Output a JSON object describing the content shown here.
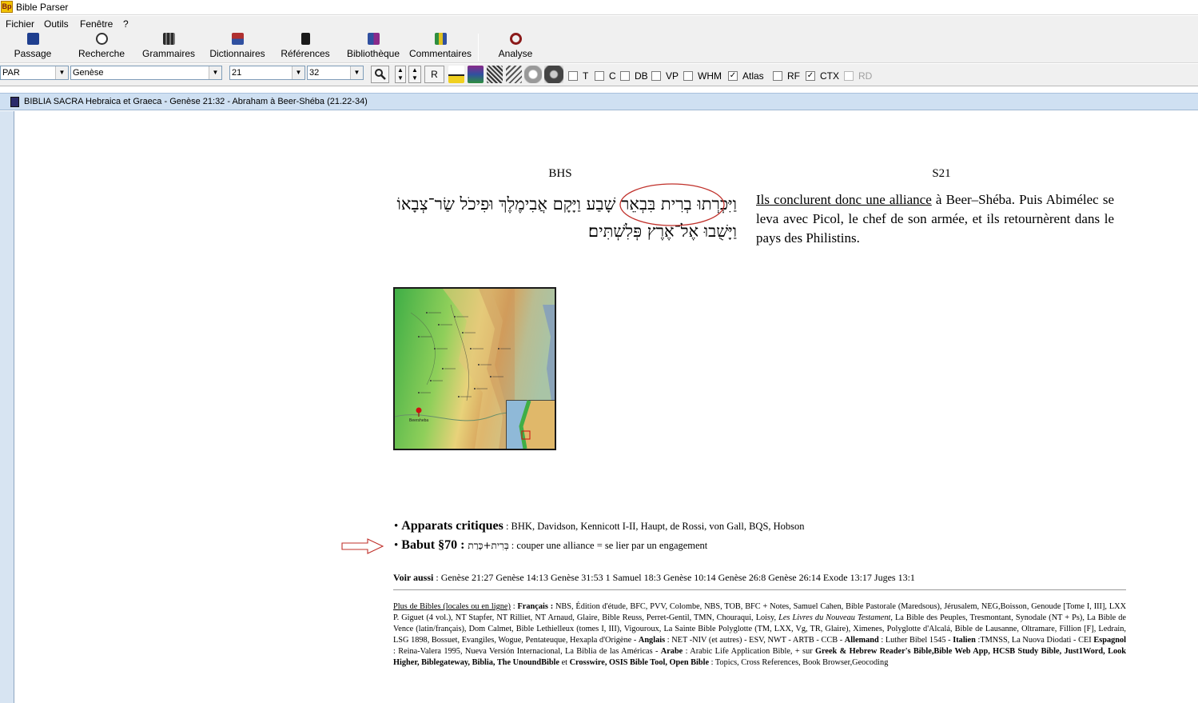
{
  "app": {
    "title": "Bible Parser",
    "icon_text": "Bp"
  },
  "menu": [
    "Fichier",
    "Outils",
    "Fenêtre",
    "?"
  ],
  "toolbar": [
    {
      "label": "Passage",
      "icon": "bible-book-icon",
      "color": "#1f3f8f"
    },
    {
      "label": "Recherche",
      "icon": "search-magnifier-icon",
      "color": "#333333"
    },
    {
      "label": "Grammaires",
      "icon": "books-icon",
      "color": "#2a2a2a"
    },
    {
      "label": "Dictionnaires",
      "icon": "dictionary-icon",
      "color": "#b03030"
    },
    {
      "label": "Références",
      "icon": "references-icon",
      "color": "#1a1a1a"
    },
    {
      "label": "Bibliothèque",
      "icon": "library-icon",
      "color": "#3050a0"
    },
    {
      "label": "Commentaires",
      "icon": "commentary-books-icon",
      "color": "#2f8f3f"
    },
    {
      "label": "Analyse",
      "icon": "analysis-magnifier-icon",
      "color": "#8b1a1a"
    }
  ],
  "selectors": {
    "version": "PAR",
    "book": "Genèse",
    "chapter": "21",
    "verse": "32",
    "r_button": "R"
  },
  "checkboxes": [
    {
      "label": "T",
      "checked": false,
      "enabled": true
    },
    {
      "label": "C",
      "checked": false,
      "enabled": true
    },
    {
      "label": "DB",
      "checked": false,
      "enabled": true
    },
    {
      "label": "VP",
      "checked": false,
      "enabled": true
    },
    {
      "label": "WHM",
      "checked": false,
      "enabled": true
    },
    {
      "label": "Atlas",
      "checked": true,
      "enabled": true
    },
    {
      "label": "RF",
      "checked": false,
      "enabled": true
    },
    {
      "label": "CTX",
      "checked": true,
      "enabled": true
    },
    {
      "label": "RD",
      "checked": false,
      "enabled": false
    }
  ],
  "window": {
    "title": "BIBLIA SACRA Hebraica et Graeca - Genèse 21:32 - Abraham à Beer-Shéba (21.22-34)"
  },
  "passage": {
    "left_header": "BHS",
    "right_header": "S21",
    "hebrew_highlight": "וַיִּכְרְתוּ בְרִית",
    "hebrew_rest": " בִּבְאֵר שָׁבַע וַיָּקָם אֲבִימֶלֶךְ וּפִיכֹל שַׂר־צְבָאוֹ וַיָּשֻׁבוּ אֶל־אֶרֶץ פְּלִשְׁתִּים׃",
    "french_underlined": "Ils conclurent donc une alliance",
    "french_rest": " à Beer–Shéba. Puis Abimélec se leva avec Picol, le chef de son armée, et ils retournèrent dans le pays des Philistins."
  },
  "map": {
    "label": "Beersheba",
    "marker_color": "#d01010"
  },
  "apparats": {
    "title": "Apparats critiques",
    "text": " : BHK, Davidson, Kennicott I-II, Haupt, de Rossi, von Gall, BQS, Hobson"
  },
  "babut": {
    "title": "Babut §70 : ",
    "hebrew": "בְּרִית+כָּרַת",
    "text": " : couper une alliance = se lier par un engagement"
  },
  "voir_aussi": {
    "label": "Voir aussi",
    "text": " : Genèse 21:27 Genèse 14:13 Genèse 31:53 1 Samuel 18:3 Genèse 10:14 Genèse 26:8 Genèse 26:14 Exode 13:17 Juges 13:1"
  },
  "plus_bibles": {
    "link": "Plus de Bibles (locales ou en ligne)",
    "p1": " : ",
    "francais_label": "Français :",
    "francais_text": " NBS, Édition d'étude, BFC, PVV, Colombe, NBS, TOB, BFC + Notes, Samuel Cahen, Bible Pastorale (Maredsous), Jérusalem, NEG,Boisson, Genoude [Tome I, III], LXX P. Giguet (4 vol.), NT Stapfer, NT Rilliet, NT Arnaud, Glaire, Bible Reuss, Perret-Gentil, TMN, Chouraqui, Loisy, ",
    "livres_italic": "Les Livres du Nouveau Testament",
    "francais_text2": ", La Bible des Peuples, Tresmontant, Synodale (NT + Ps), La Bible de Vence (latin/français), Dom Calmet, Bible Lethielleux (tomes I, III), Vigouroux, La Sainte Bible Polyglotte (TM, LXX, Vg, TR, Glaire), Ximenes, Polyglotte d'Alcalá, Bible de Lausanne, Oltramare, Fillion [F], Ledrain, LSG 1898, Bossuet, Evangiles, Wogue, Pentateuque, Hexapla d'Origène - ",
    "anglais_label": "Anglais",
    "anglais_text": " : NET -NIV (et autres) - ESV, NWT - ARTB - CCB - ",
    "allemand_label": "Allemand",
    "allemand_text": " : Luther Bibel 1545 - ",
    "italien_label": "Italien",
    "italien_text": " :TMNSS, La Nuova Diodati - CEI ",
    "espagnol_label": "Espagnol",
    "espagnol_text": " : Reina-Valera 1995, Nueva Versión Internacional, La Biblia de las Américas - ",
    "arabe_label": "Arabe",
    "arabe_text": " : Arabic Life Application Bible, + sur ",
    "greek_label": "Greek & Hebrew Reader's Bible,Bible Web App, HCSB Study Bible, Just1Word, Look Higher, Biblegateway, Biblia, The UnoundBible",
    "et": " et ",
    "crosswire_label": "Crosswire, OSIS Bible Tool, Open Bible",
    "end_text": " : Topics, Cross References, Book Browser,Geocoding"
  }
}
